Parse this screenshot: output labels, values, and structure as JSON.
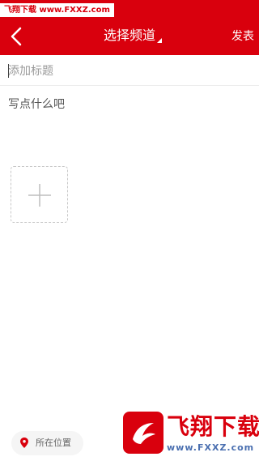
{
  "watermark": {
    "top_text": "飞翔下载 www.FXXZ.com",
    "logo_title": "飞翔下载",
    "logo_url": "www.FXXZ.com"
  },
  "header": {
    "title": "选择频道",
    "publish_label": "发表",
    "back_icon": "chevron-left-icon",
    "background_color": "#d9000d"
  },
  "compose": {
    "title_placeholder": "添加标题",
    "body_placeholder": "写点什么吧",
    "add_image_icon": "plus-icon"
  },
  "location": {
    "label": "所在位置",
    "icon": "location-pin-icon",
    "icon_color": "#d9000d"
  }
}
